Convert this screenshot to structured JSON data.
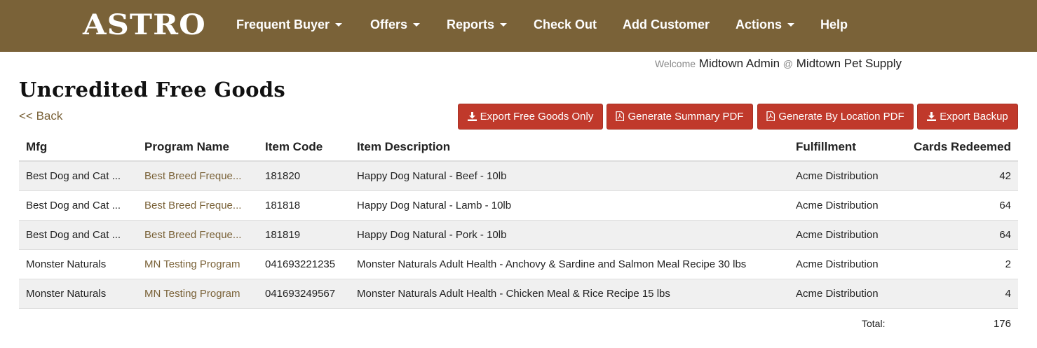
{
  "header": {
    "logo": "ASTRO",
    "nav": [
      {
        "label": "Frequent Buyer",
        "dropdown": true
      },
      {
        "label": "Offers",
        "dropdown": true
      },
      {
        "label": "Reports",
        "dropdown": true
      },
      {
        "label": "Check Out",
        "dropdown": false
      },
      {
        "label": "Add Customer",
        "dropdown": false
      },
      {
        "label": "Actions",
        "dropdown": true
      },
      {
        "label": "Help",
        "dropdown": false
      }
    ]
  },
  "welcome": {
    "prefix": "Welcome",
    "user": "Midtown Admin",
    "at": "@",
    "store": "Midtown Pet Supply"
  },
  "page": {
    "title": "Uncredited Free Goods",
    "back_label": "<< Back"
  },
  "buttons": {
    "export_free_goods": "Export Free Goods Only",
    "summary_pdf": "Generate Summary PDF",
    "location_pdf": "Generate By Location PDF",
    "export_backup": "Export Backup"
  },
  "table": {
    "columns": [
      "Mfg",
      "Program Name",
      "Item Code",
      "Item Description",
      "Fulfillment",
      "Cards Redeemed"
    ],
    "rows": [
      {
        "mfg": "Best Dog and Cat ...",
        "program": "Best Breed Freque...",
        "item_code": "181820",
        "description": "Happy Dog Natural - Beef - 10lb",
        "fulfillment": "Acme Distribution",
        "cards": "42"
      },
      {
        "mfg": "Best Dog and Cat ...",
        "program": "Best Breed Freque...",
        "item_code": "181818",
        "description": "Happy Dog Natural - Lamb - 10lb",
        "fulfillment": "Acme Distribution",
        "cards": "64"
      },
      {
        "mfg": "Best Dog and Cat ...",
        "program": "Best Breed Freque...",
        "item_code": "181819",
        "description": "Happy Dog Natural - Pork - 10lb",
        "fulfillment": "Acme Distribution",
        "cards": "64"
      },
      {
        "mfg": "Monster Naturals",
        "program": "MN Testing Program",
        "item_code": "041693221235",
        "description": "Monster Naturals Adult Health - Anchovy & Sardine and Salmon Meal Recipe 30 lbs",
        "fulfillment": "Acme Distribution",
        "cards": "2"
      },
      {
        "mfg": "Monster Naturals",
        "program": "MN Testing Program",
        "item_code": "041693249567",
        "description": "Monster Naturals Adult Health - Chicken Meal & Rice Recipe 15 lbs",
        "fulfillment": "Acme Distribution",
        "cards": "4"
      }
    ],
    "total_label": "Total:",
    "total_value": "176"
  },
  "colors": {
    "navbar": "#7a6238",
    "button": "#c0392b",
    "link": "#7a6238",
    "stripe": "#f0f0f0"
  },
  "icons": {
    "export": "download-icon",
    "pdf": "pdf-file-icon"
  }
}
